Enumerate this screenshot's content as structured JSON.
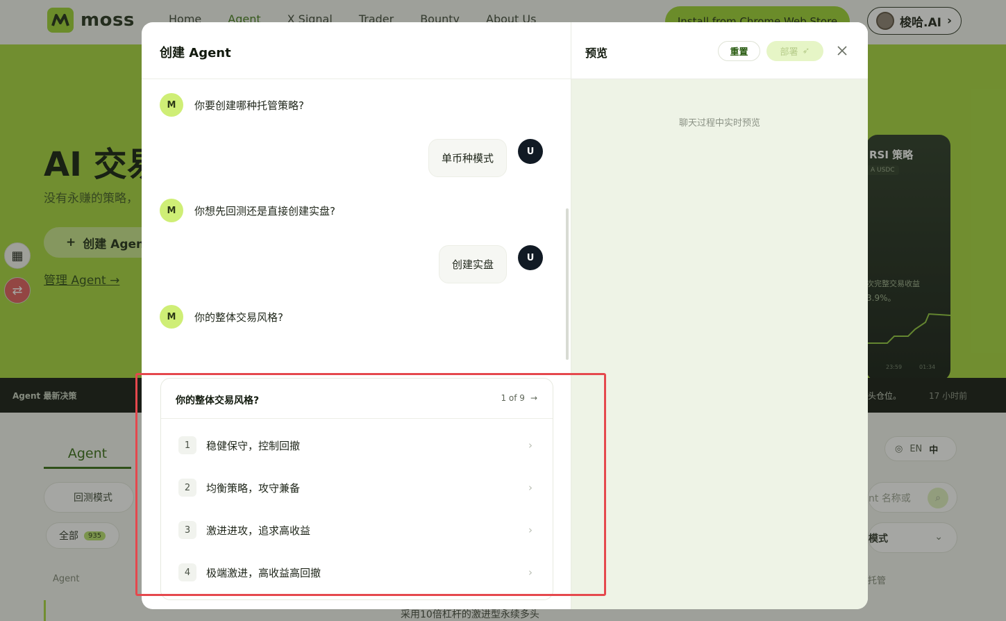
{
  "background": {
    "logo_text": "moss",
    "nav": [
      "Home",
      "Agent",
      "X Signal",
      "Trader",
      "Bounty",
      "About Us"
    ],
    "install_btn": "Install from Chrome Web Store",
    "user_name": "梭哈.AI",
    "hero_title": "AI 交易",
    "hero_sub": "没有永赚的策略，",
    "hero_create": "创建 Agent",
    "hero_manage": "管理 Agent",
    "strategy_card": {
      "title": "RSI 策略",
      "tag": "A USDC",
      "line1": "次完整交易收益",
      "line2": "3.9%。",
      "time1": "23:59",
      "time2": "01:34"
    },
    "ticker": {
      "label": "Agent 最新决策",
      "right_text": "头仓位。",
      "right_time": "17 小时前"
    },
    "tab_agent": "Agent",
    "backtest_pill": "回测模式",
    "all_pill": "全部",
    "all_count": "935",
    "col_agent": "Agent",
    "bottom_text": "采用10倍杠杆的激进型永续多头",
    "lang_en": "EN",
    "lang_zh": "中",
    "search_text": "nt 名称或",
    "mode_text": "模式",
    "col_right": "托管"
  },
  "chat": {
    "title": "创建 Agent",
    "bot_avatar": "M",
    "user_avatar": "U",
    "messages": [
      {
        "role": "bot",
        "text": "你要创建哪种托管策略?"
      },
      {
        "role": "user",
        "text": "单币种模式"
      },
      {
        "role": "bot",
        "text": "你想先回测还是直接创建实盘?"
      },
      {
        "role": "user",
        "text": "创建实盘"
      },
      {
        "role": "bot",
        "text": "你的整体交易风格?"
      }
    ]
  },
  "question": {
    "title": "你的整体交易风格?",
    "page": "1 of 9",
    "options": [
      {
        "num": "1",
        "label": "稳健保守，控制回撤"
      },
      {
        "num": "2",
        "label": "均衡策略，攻守兼备"
      },
      {
        "num": "3",
        "label": "激进进攻，追求高收益"
      },
      {
        "num": "4",
        "label": "极端激进，高收益高回撤"
      }
    ]
  },
  "preview": {
    "title": "预览",
    "reset": "重置",
    "deploy": "部署",
    "hint": "聊天过程中实时预览"
  },
  "colors": {
    "accent": "#9cd22f",
    "hero_bg": "#a5d63a",
    "highlight": "#e5484d"
  }
}
